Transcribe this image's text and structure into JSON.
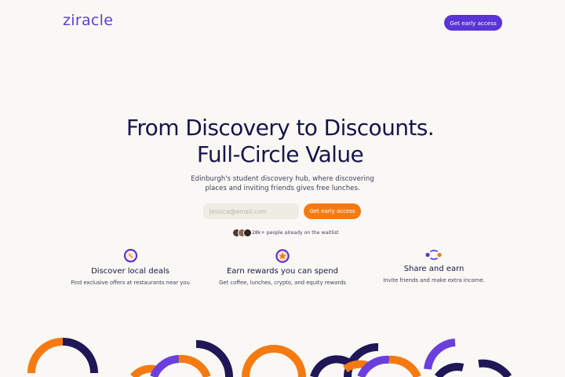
{
  "brand": {
    "logo": "ziracle",
    "accent": "#5b34d6",
    "orange": "#f57a12",
    "navy": "#16154a"
  },
  "header": {
    "cta_label": "Get early access"
  },
  "hero": {
    "title_line1": "From Discovery to Discounts.",
    "title_line2": "Full-Circle Value",
    "subtitle_line1": "Edinburgh's student discovery hub, where discovering",
    "subtitle_line2": "places and inviting friends gives free lunches.",
    "email_placeholder": "Jessica@email.com",
    "cta_label": "Get early access",
    "waitlist_text": "28k+ people already on the waitlist"
  },
  "features": [
    {
      "icon": "compass-icon",
      "title": "Discover local deals",
      "desc": "Find exclusive offers at restaurants near you"
    },
    {
      "icon": "star-badge-icon",
      "title": "Earn rewards you can spend",
      "desc": "Get coffee, lunches, crypto, and equity rewards"
    },
    {
      "icon": "share-nodes-icon",
      "title": "Share and earn",
      "desc": "Invite friends and make extra income."
    }
  ]
}
